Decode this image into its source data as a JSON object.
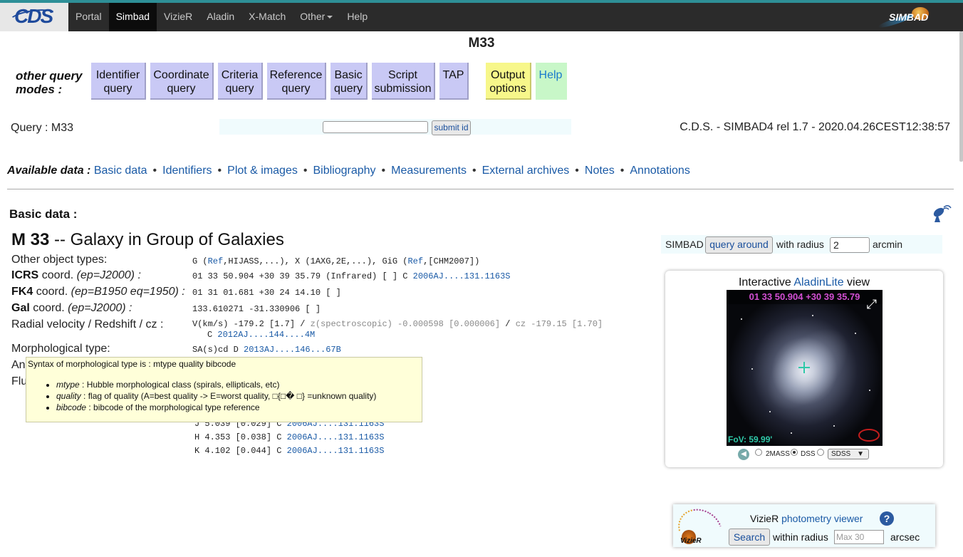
{
  "nav": {
    "logo_text": "CDS",
    "items": [
      "Portal",
      "Simbad",
      "VizieR",
      "Aladin",
      "X-Match",
      "Other",
      "Help"
    ],
    "active": "Simbad",
    "simbad_logo_text": "SIMBAD"
  },
  "page_title": "M33",
  "query_modes": {
    "label_line1": "other query",
    "label_line2": "modes :",
    "buttons": [
      {
        "line1": "Identifier",
        "line2": "query"
      },
      {
        "line1": "Coordinate",
        "line2": "query"
      },
      {
        "line1": "Criteria",
        "line2": "query"
      },
      {
        "line1": "Reference",
        "line2": "query"
      },
      {
        "line1": "Basic",
        "line2": "query"
      },
      {
        "line1": "Script",
        "line2": "submission"
      },
      {
        "line1": "TAP",
        "line2": ""
      },
      {
        "line1": "Output",
        "line2": "options"
      },
      {
        "line1": "Help",
        "line2": ""
      }
    ]
  },
  "query": {
    "label": "Query : M33",
    "input_value": "",
    "submit_label": "submit id",
    "version": "C.D.S. - SIMBAD4 rel 1.7 - 2020.04.26CEST12:38:57"
  },
  "available": {
    "label": "Available data :",
    "links": [
      "Basic data",
      "Identifiers",
      "Plot & images",
      "Bibliography",
      "Measurements",
      "External archives",
      "Notes",
      "Annotations"
    ]
  },
  "basic": {
    "heading": "Basic data :",
    "object_name": "M 33",
    "object_type": "-- Galaxy in Group of Galaxies",
    "other_types_label": "Other object types:",
    "other_types": {
      "t1": "G",
      "t1_paren_open": "(",
      "t1_ref": "Ref",
      "t1_rest": ",HIJASS,...),",
      "t2": "X (1AXG,2E,...),",
      "t3": "GiG",
      "t3_paren_open": "(",
      "t3_ref": "Ref",
      "t3_rest": ",[CHM2007])"
    },
    "icrs": {
      "label_b": "ICRS",
      "label_rest": "coord.",
      "epoch": "(ep=J2000) :",
      "value": "01 33 50.904 +30 39 35.79 (Infrared) [ ] C",
      "ref": "2006AJ....131.1163S"
    },
    "fk4": {
      "label_b": "FK4",
      "label_rest": "coord.",
      "epoch": "(ep=B1950 eq=1950) :",
      "value": "01 31 01.681 +30 24 14.10 [ ]"
    },
    "gal": {
      "label_b": "Gal",
      "label_rest": "coord.",
      "epoch": "(ep=J2000) :",
      "value": "133.610271 -31.330906 [ ]"
    },
    "radial": {
      "label": "Radial velocity / Redshift / cz :",
      "v_part": "V(km/s) -179.2 [1.7] /",
      "z_part": "z(spectroscopic) -0.000598 [0.000006]",
      "slash": "/",
      "cz_part": "cz -179.15 [1.70]",
      "line2_prefix": "C",
      "ref": "2012AJ....144....4M"
    },
    "morph": {
      "label": "Morphological type:",
      "value": "SA(s)cd D",
      "ref": "2013AJ....146...67B"
    },
    "ang_label": "Ang",
    "flux_label": "Flu",
    "flux_rows": [
      {
        "value": "J 5.039 [0.029] C",
        "ref": "2006AJ....131.1163S"
      },
      {
        "value": "H 4.353 [0.038] C",
        "ref": "2006AJ....131.1163S"
      },
      {
        "value": "K 4.102 [0.044] C",
        "ref": "2006AJ....131.1163S"
      }
    ]
  },
  "tooltip": {
    "header": "Syntax of morphological type is : mtype quality bibcode",
    "items": [
      {
        "term": "mtype",
        "desc": ": Hubble morphological class (spirals, ellipticals, etc)"
      },
      {
        "term": "quality",
        "desc": ": flag of quality (A=best quality -> E=worst quality, □{□� □} =unknown quality)"
      },
      {
        "term": "bibcode",
        "desc": ": bibcode of the morphological type reference"
      }
    ]
  },
  "query_around": {
    "prefix": "SIMBAD",
    "button_label": "query around",
    "mid": "with radius",
    "radius_value": "2",
    "unit": "arcmin"
  },
  "aladin": {
    "title_prefix": "Interactive",
    "title_link": "AladinLite",
    "title_suffix": "view",
    "coord_readout": "01 33 50.904 +30 39 35.79",
    "fov": "FoV: 59.99'",
    "surveys": [
      "2MASS",
      "DSS"
    ],
    "selected_survey": "DSS",
    "select_value": "SDSS"
  },
  "vizier": {
    "title_prefix": "VizieR",
    "title_link": "photometry viewer",
    "search_label": "Search",
    "within": "within radius",
    "radius_placeholder": "Max 30",
    "unit": "arcsec",
    "logo_text": "VizieR"
  }
}
